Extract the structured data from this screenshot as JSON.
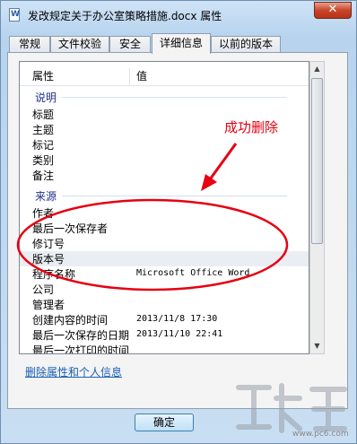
{
  "window": {
    "title": "发改规定关于办公室策略措施.docx 属性",
    "close_glyph": "✕"
  },
  "tabs": [
    {
      "label": "常规",
      "active": false
    },
    {
      "label": "文件校验",
      "active": false
    },
    {
      "label": "安全",
      "active": false
    },
    {
      "label": "详细信息",
      "active": true
    },
    {
      "label": "以前的版本",
      "active": false
    }
  ],
  "table": {
    "col_property": "属性",
    "col_value": "值",
    "sections": [
      {
        "label": "说明",
        "rows": [
          {
            "name": "标题",
            "value": ""
          },
          {
            "name": "主题",
            "value": ""
          },
          {
            "name": "标记",
            "value": ""
          },
          {
            "name": "类别",
            "value": ""
          },
          {
            "name": "备注",
            "value": ""
          }
        ]
      },
      {
        "label": "来源",
        "rows": [
          {
            "name": "作者",
            "value": ""
          },
          {
            "name": "最后一次保存者",
            "value": ""
          },
          {
            "name": "修订号",
            "value": ""
          },
          {
            "name": "版本号",
            "value": ""
          },
          {
            "name": "程序名称",
            "value": "Microsoft Office Word"
          },
          {
            "name": "公司",
            "value": ""
          },
          {
            "name": "管理者",
            "value": ""
          },
          {
            "name": "创建内容的时间",
            "value": "2013/11/8 17:30"
          },
          {
            "name": "最后一次保存的日期",
            "value": "2013/11/10 22:41"
          },
          {
            "name": "最后一次打印的时间",
            "value": ""
          }
        ]
      }
    ]
  },
  "remove_link": "删除属性和个人信息",
  "ok_button": "确定",
  "annotation": {
    "text": "成功删除",
    "color": "#e60012"
  },
  "scrollbar": {
    "up": "▲",
    "down": "▼"
  }
}
